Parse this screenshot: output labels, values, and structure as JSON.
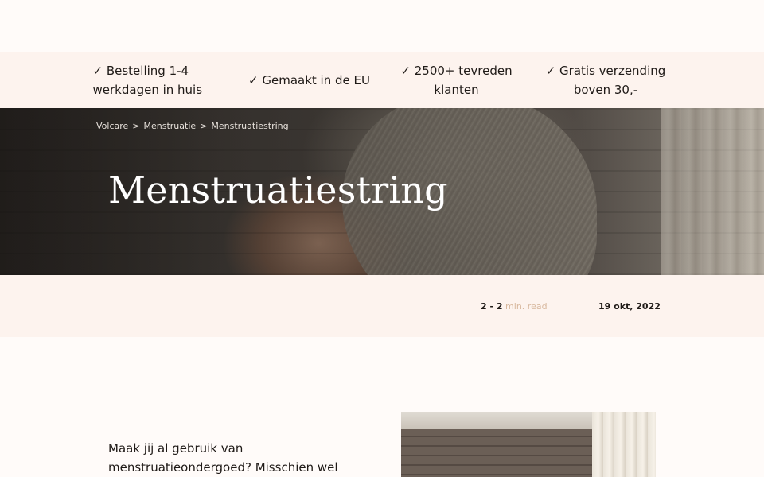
{
  "usp_bar": {
    "items": [
      "✓ Bestelling 1-4 werkdagen in huis",
      "✓ Gemaakt in de EU",
      "✓ 2500+ tevreden klanten",
      "✓ Gratis verzending boven 30,-"
    ]
  },
  "breadcrumb": {
    "items": [
      "Volcare",
      "Menstruatie",
      "Menstruatiestring"
    ],
    "separator": ">"
  },
  "hero": {
    "title": "Menstruatiestring"
  },
  "meta": {
    "read_time_value": "2 - 2",
    "read_time_unit": "min. read",
    "date": "19 okt, 2022"
  },
  "article": {
    "intro": "Maak jij al gebruik van menstruatieondergoed? Misschien wel"
  },
  "colors": {
    "background": "#fffbf9",
    "band": "#fdf3ee",
    "accent": "#d8b89e",
    "text": "#1f1a17"
  }
}
